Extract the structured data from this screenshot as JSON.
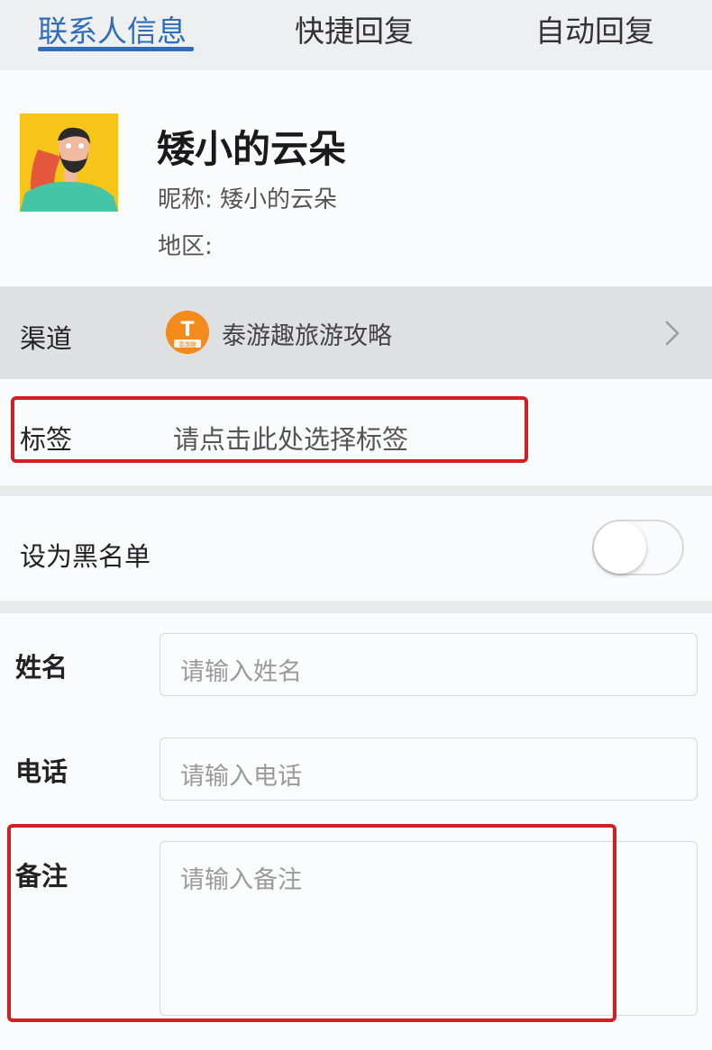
{
  "tabs": [
    {
      "label": "联系人信息",
      "active": true
    },
    {
      "label": "快捷回复",
      "active": false
    },
    {
      "label": "自动回复",
      "active": false
    }
  ],
  "profile": {
    "display_name": "矮小的云朵",
    "nickname_label": "昵称:",
    "nickname_value": "矮小的云朵",
    "region_label": "地区:",
    "region_value": ""
  },
  "channel": {
    "label": "渠道",
    "name": "泰游趣旅游攻略",
    "icon_letter": "T",
    "icon_caption": "泰游趣"
  },
  "tag": {
    "label": "标签",
    "placeholder": "请点击此处选择标签"
  },
  "blacklist": {
    "label": "设为黑名单",
    "enabled": false
  },
  "form": {
    "name_label": "姓名",
    "name_placeholder": "请输入姓名",
    "phone_label": "电话",
    "phone_placeholder": "请输入电话",
    "note_label": "备注",
    "note_placeholder": "请输入备注"
  },
  "colors": {
    "accent": "#2f6db8",
    "highlight_red": "#d21f24",
    "avatar_bg": "#f7c41a",
    "channel_icon_bg": "#f28a1c"
  },
  "icons": [
    "avatar-image",
    "channel-logo-icon",
    "chevron-right-icon",
    "toggle-switch"
  ]
}
